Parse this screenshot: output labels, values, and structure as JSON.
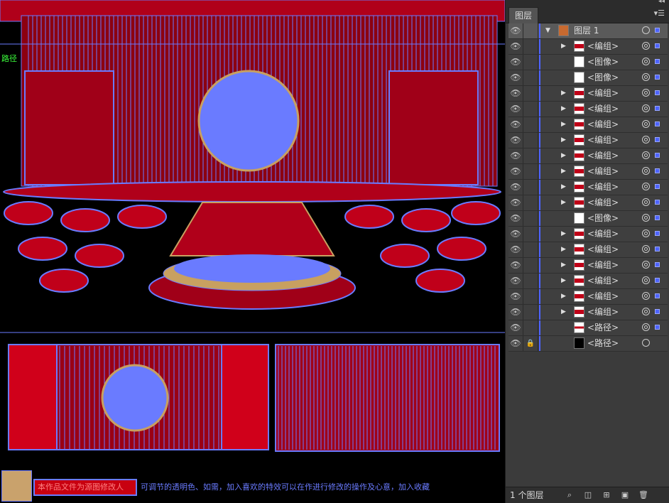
{
  "canvas": {
    "path_tag": "路径",
    "notice_label": "本作品文件为源图修改人",
    "notice_text": "可调节的透明色、如需，加入喜欢的特效可以在作进行修改的操作及心意，加入收藏"
  },
  "panel": {
    "tab_title": "图层",
    "collapse_glyph": "◂◂",
    "menu_glyph": "▾☰",
    "top_layer": {
      "label": "图层 1"
    },
    "items": [
      {
        "label": "<编组>",
        "expandable": true,
        "thumb": "group"
      },
      {
        "label": "<图像>",
        "expandable": false,
        "thumb": "image"
      },
      {
        "label": "<图像>",
        "expandable": false,
        "thumb": "image"
      },
      {
        "label": "<编组>",
        "expandable": true,
        "thumb": "group"
      },
      {
        "label": "<编组>",
        "expandable": true,
        "thumb": "group"
      },
      {
        "label": "<编组>",
        "expandable": true,
        "thumb": "group"
      },
      {
        "label": "<编组>",
        "expandable": true,
        "thumb": "group"
      },
      {
        "label": "<编组>",
        "expandable": true,
        "thumb": "group"
      },
      {
        "label": "<编组>",
        "expandable": true,
        "thumb": "group"
      },
      {
        "label": "<编组>",
        "expandable": true,
        "thumb": "group"
      },
      {
        "label": "<编组>",
        "expandable": true,
        "thumb": "group"
      },
      {
        "label": "<图像>",
        "expandable": false,
        "thumb": "image"
      },
      {
        "label": "<编组>",
        "expandable": true,
        "thumb": "group"
      },
      {
        "label": "<编组>",
        "expandable": true,
        "thumb": "group"
      },
      {
        "label": "<编组>",
        "expandable": true,
        "thumb": "group"
      },
      {
        "label": "<编组>",
        "expandable": true,
        "thumb": "group"
      },
      {
        "label": "<编组>",
        "expandable": true,
        "thumb": "group"
      },
      {
        "label": "<编组>",
        "expandable": true,
        "thumb": "group"
      },
      {
        "label": "<路径>",
        "expandable": false,
        "thumb": "path"
      },
      {
        "label": "<路径>",
        "expandable": false,
        "thumb": "path-black",
        "locked": true
      }
    ],
    "status": "1 个图层"
  },
  "colors": {
    "selection": "#6a7bff",
    "stage_red": "#b0001a",
    "panel_bg": "#3b3b3b",
    "layer_color": "#4d63ff"
  }
}
